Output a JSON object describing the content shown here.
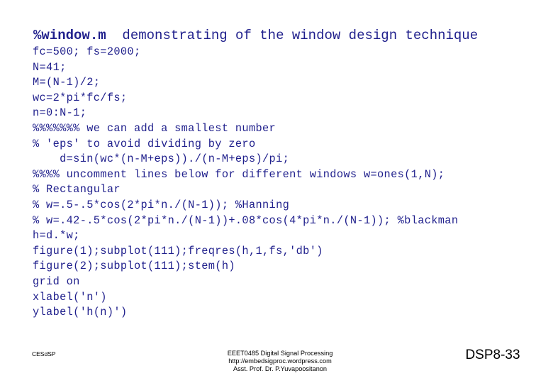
{
  "slide": {
    "background_color": "#ffffff",
    "code_color": "#1f1f8c",
    "footer_color": "#000000"
  },
  "title": {
    "bold_part": "%window.m",
    "rest_part": "  demonstrating of the window design technique"
  },
  "code": {
    "lines": [
      "fc=500; fs=2000;",
      "N=41;",
      "M=(N-1)/2;",
      "wc=2*pi*fc/fs;",
      "n=0:N-1;",
      "%%%%%%% we can add a smallest number",
      "% 'eps' to avoid dividing by zero",
      "    d=sin(wc*(n-M+eps))./(n-M+eps)/pi;",
      "%%%% uncomment lines below for different windows w=ones(1,N);",
      "% Rectangular",
      "% w=.5-.5*cos(2*pi*n./(N-1)); %Hanning",
      "% w=.42-.5*cos(2*pi*n./(N-1))+.08*cos(4*pi*n./(N-1)); %blackman",
      "h=d.*w;",
      "figure(1);subplot(111);freqres(h,1,fs,'db')",
      "figure(2);subplot(111);stem(h)",
      "grid on",
      "xlabel('n')",
      "ylabel('h(n)')"
    ]
  },
  "footer": {
    "left_label": "CESdSP",
    "center_line1": "EEET0485 Digital Signal Processing",
    "center_line2": "http://embedsigproc.wordpress.com",
    "center_line3": "Asst. Prof. Dr. P.Yuvapoositanon",
    "page_label": "DSP8-33"
  }
}
